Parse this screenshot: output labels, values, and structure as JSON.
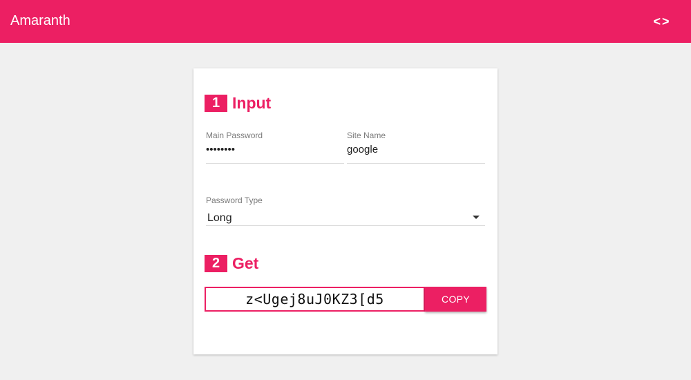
{
  "app": {
    "title": "Amaranth",
    "code_icon": "code-brackets-icon",
    "code_glyph": "<>"
  },
  "colors": {
    "accent": "#ec1f63",
    "background": "#f0f0f0",
    "card": "#ffffff"
  },
  "input_section": {
    "step_number": "1",
    "title": "Input",
    "main_password": {
      "label": "Main Password",
      "value": "••••••••"
    },
    "site_name": {
      "label": "Site Name",
      "value": "google"
    },
    "password_type": {
      "label": "Password Type",
      "selected": "Long",
      "dropdown_icon": "arrow-drop-down-icon"
    }
  },
  "get_section": {
    "step_number": "2",
    "title": "Get",
    "generated_password": "z<Ugej8uJ0KZ3[d5",
    "copy_label": "COPY"
  }
}
